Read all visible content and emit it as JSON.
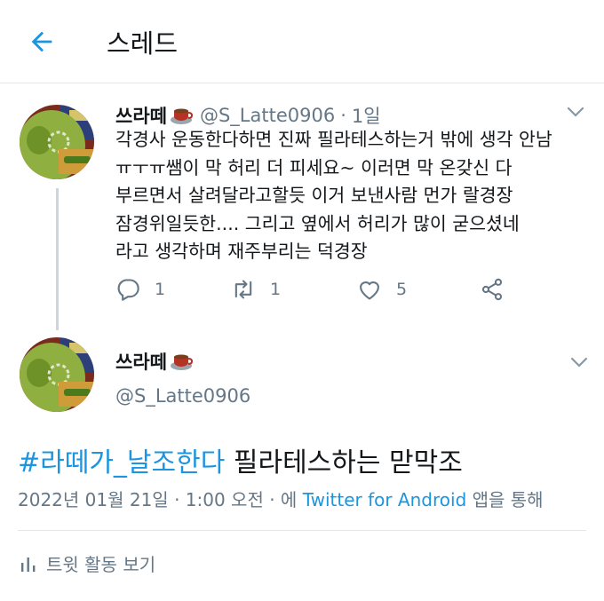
{
  "header": {
    "title": "스레드",
    "back_icon": "arrow-left-icon"
  },
  "colors": {
    "accent": "#1b95e0",
    "text": "#14171a",
    "muted": "#657786",
    "divider": "#e1e8ed"
  },
  "reply_tweet": {
    "display_name": "쓰라떼",
    "emoji": "coffee-icon",
    "handle": "@S_Latte0906",
    "separator": "·",
    "time": "1일",
    "lines": [
      "각경사 운동한다하면 진짜 필라테스하는거 밖에 생각 안남",
      "ㅠㅜㅠ쌤이 막 허리 더 피세요~ 이러면 막 온갖신 다",
      "부르면서 살려달라고할듯 이거 보낸사람 먼가 랄경장",
      "잠경위일듯한.... 그리고 옆에서 허리가 많이 굳으셨네",
      "라고 생각하며 재주부리는 덕경장"
    ],
    "actions": {
      "reply_count": "1",
      "retweet_count": "1",
      "like_count": "5"
    }
  },
  "main_tweet": {
    "display_name": "쓰라떼",
    "emoji": "coffee-icon",
    "handle": "@S_Latte0906",
    "hashtag": "#라떼가_날조한다",
    "text_rest": " 필라테스하는 맏막조",
    "timestamp": "2022년 01월 21일 · 1:00 오전 · 에",
    "source": "Twitter for Android",
    "source_suffix": "앱을 통해"
  },
  "activity": {
    "label": "트윗 활동 보기"
  }
}
